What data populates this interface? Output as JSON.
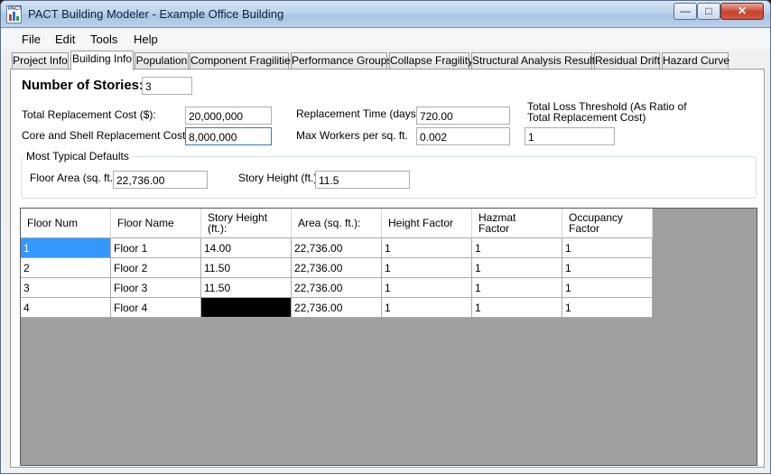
{
  "window": {
    "title": "PACT Building Modeler - Example Office Building",
    "icon_text": "PACT",
    "controls": {
      "minimize": "—",
      "maximize": "□",
      "close": "✕"
    }
  },
  "menu": [
    "File",
    "Edit",
    "Tools",
    "Help"
  ],
  "tabs": [
    "Project Info",
    "Building Info",
    "Population",
    "Component Fragilities",
    "Performance Groups",
    "Collapse Fragility",
    "Structural Analysis Results",
    "Residual Drift",
    "Hazard Curve"
  ],
  "active_tab": "Building Info",
  "form": {
    "stories_label": "Number of Stories:",
    "stories_value": "3",
    "total_cost_label": "Total Replacement Cost ($):",
    "total_cost_value": "20,000,000",
    "core_cost_label": "Core and Shell Replacement Cost ($):",
    "core_cost_value": "8,000,000",
    "replacement_time_label": "Replacement Time (days):",
    "replacement_time_value": "720.00",
    "max_workers_label": "Max Workers per sq. ft.",
    "max_workers_value": "0.002",
    "loss_threshold_label_1": "Total Loss Threshold (As Ratio of",
    "loss_threshold_label_2": "Total Replacement Cost)",
    "loss_threshold_value": "1"
  },
  "defaults": {
    "legend": "Most Typical Defaults",
    "floor_area_label": "Floor Area (sq. ft.):",
    "floor_area_value": "22,736.00",
    "story_height_label": "Story Height (ft.):",
    "story_height_value": "11.5"
  },
  "grid": {
    "headers": [
      [
        "Floor Num"
      ],
      [
        "Floor Name"
      ],
      [
        "Story Height",
        "(ft.):"
      ],
      [
        "Area (sq. ft.):"
      ],
      [
        "Height Factor"
      ],
      [
        "Hazmat",
        "Factor"
      ],
      [
        "Occupancy",
        "Factor"
      ]
    ],
    "rows": [
      [
        "1",
        "Floor 1",
        "14.00",
        "22,736.00",
        "1",
        "1",
        "1"
      ],
      [
        "2",
        "Floor 2",
        "11.50",
        "22,736.00",
        "1",
        "1",
        "1"
      ],
      [
        "3",
        "Floor 3",
        "11.50",
        "22,736.00",
        "1",
        "1",
        "1"
      ],
      [
        "4",
        "Floor 4",
        "",
        "22,736.00",
        "1",
        "1",
        "1"
      ]
    ]
  }
}
